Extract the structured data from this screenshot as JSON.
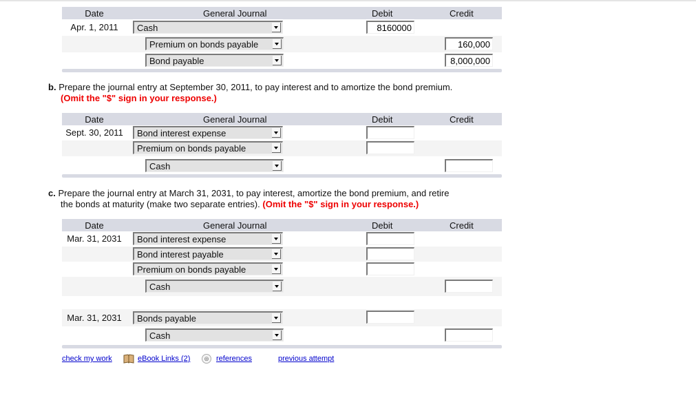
{
  "headers": {
    "date": "Date",
    "general_journal": "General Journal",
    "debit": "Debit",
    "credit": "Credit"
  },
  "part_a": {
    "rows": [
      {
        "date": "Apr. 1, 2011",
        "account": "Cash",
        "debit": "8160000",
        "credit": null
      },
      {
        "date": "",
        "account": "Premium on bonds payable",
        "debit": null,
        "credit": "160,000"
      },
      {
        "date": "",
        "account": "Bond payable",
        "debit": null,
        "credit": "8,000,000"
      }
    ]
  },
  "part_b": {
    "label": "b.",
    "text": "Prepare the journal entry at September 30, 2011, to pay interest and to amortize the bond premium.",
    "note": "(Omit the \"$\" sign in your response.)",
    "rows": [
      {
        "date": "Sept. 30, 2011",
        "account": "Bond interest expense",
        "debit": "",
        "credit": null
      },
      {
        "date": "",
        "account": "Premium on bonds payable",
        "debit": "",
        "credit": null
      },
      {
        "date": "",
        "account": "Cash",
        "debit": null,
        "credit": ""
      }
    ]
  },
  "part_c": {
    "label": "c.",
    "text_line1": "Prepare the journal entry at March 31, 2031, to pay interest, amortize the bond premium, and retire",
    "text_line2": "the bonds at maturity (make two separate entries).",
    "note": "(Omit the \"$\" sign in your response.)",
    "entry1": [
      {
        "date": "Mar. 31, 2031",
        "account": "Bond interest expense",
        "debit": "",
        "credit": null
      },
      {
        "date": "",
        "account": "Bond interest payable",
        "debit": "",
        "credit": null
      },
      {
        "date": "",
        "account": "Premium on bonds payable",
        "debit": "",
        "credit": null
      },
      {
        "date": "",
        "account": "Cash",
        "debit": null,
        "credit": ""
      }
    ],
    "entry2": [
      {
        "date": "Mar. 31, 2031",
        "account": "Bonds payable",
        "debit": "",
        "credit": null
      },
      {
        "date": "",
        "account": "Cash",
        "debit": null,
        "credit": ""
      }
    ]
  },
  "footer": {
    "check_my_work": "check my work",
    "ebook_links": "eBook Links (2)",
    "references": "references",
    "previous_attempt": "previous attempt"
  }
}
